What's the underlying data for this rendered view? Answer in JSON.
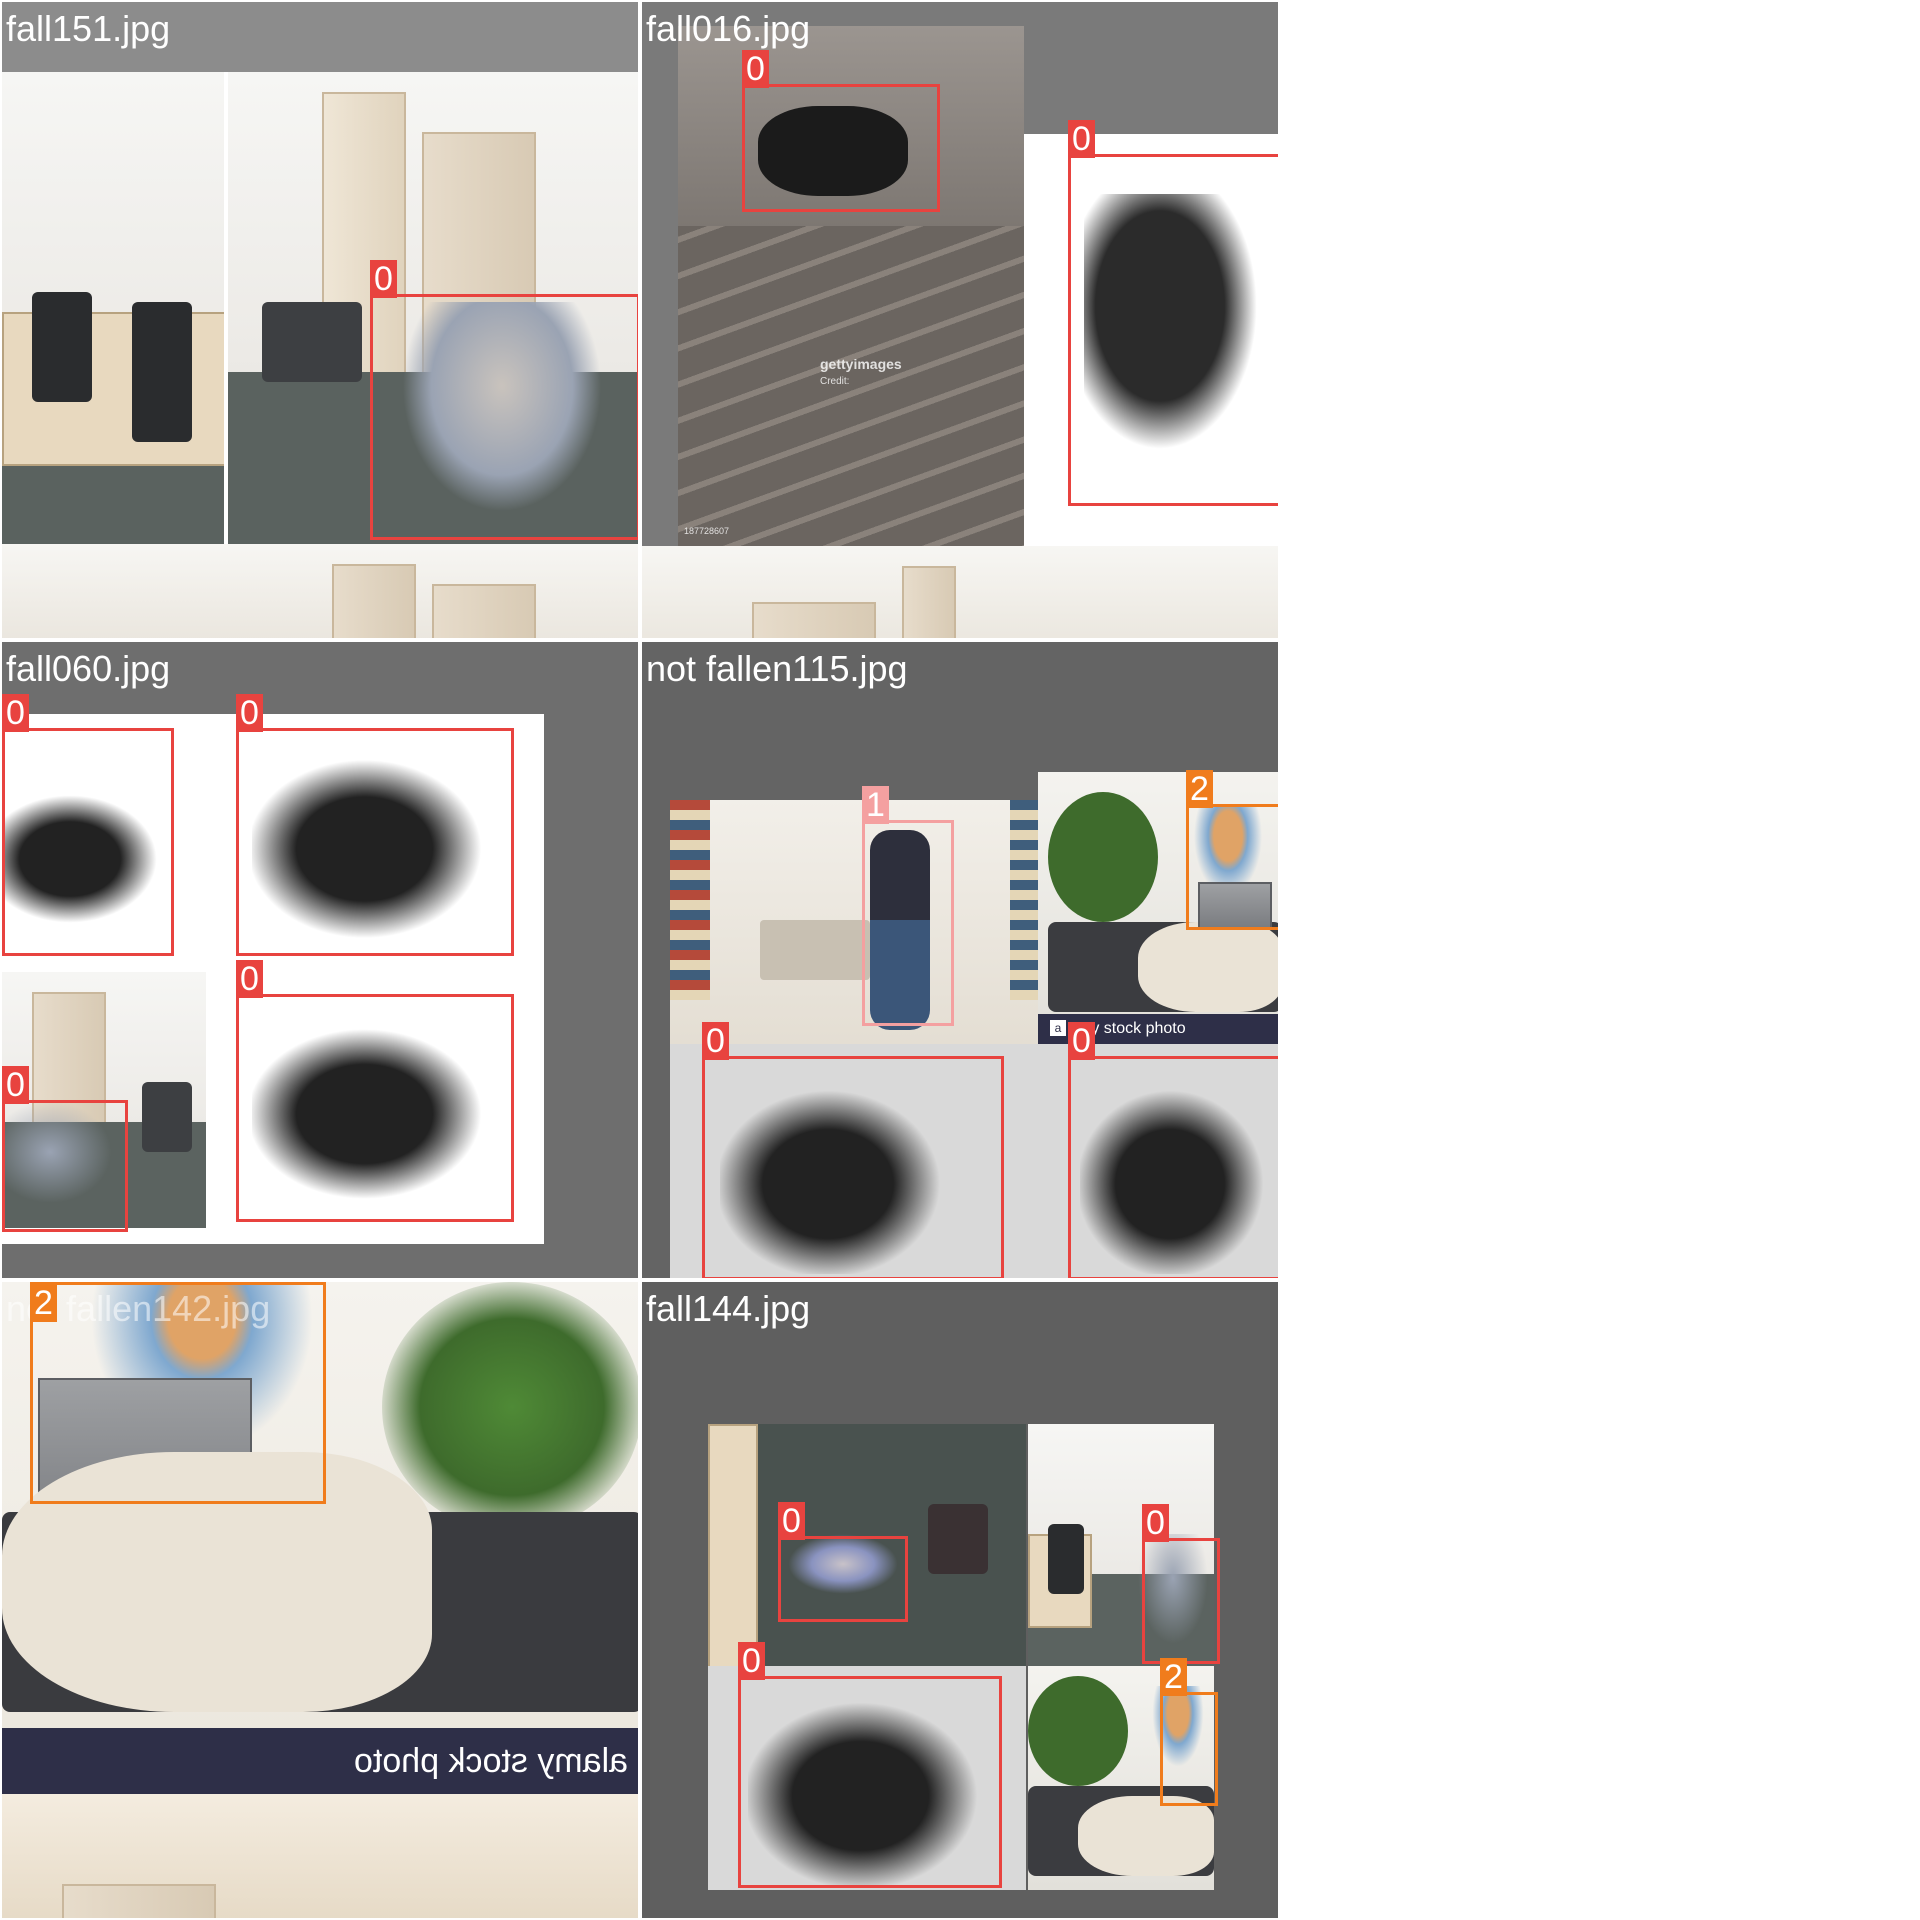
{
  "tiles": [
    {
      "title": "fall151.jpg",
      "bg": "#8c8c8c",
      "labels": [
        "0"
      ]
    },
    {
      "title": "fall016.jpg",
      "bg": "#7a7a7a",
      "labels": [
        "0",
        "0"
      ],
      "watermark": "gettyimages",
      "watermark_sub": "Credit:",
      "image_id": "187728607"
    },
    {
      "title": "fall060.jpg",
      "bg": "#6e6e6e",
      "labels": [
        "0",
        "0",
        "0",
        "0"
      ]
    },
    {
      "title": "not fallen115.jpg",
      "bg": "#646464",
      "labels": [
        "1",
        "2",
        "0",
        "0"
      ],
      "stock_text": "my stock photo",
      "stock_badge": "a"
    },
    {
      "title": "not fallen142.jpg",
      "bg": "#ffffff",
      "labels": [
        "2"
      ],
      "stock_text": "alamy stock photo"
    },
    {
      "title": "fall144.jpg",
      "bg": "#5f5f5f",
      "labels": [
        "0",
        "0",
        "0",
        "2"
      ]
    }
  ],
  "colors": {
    "class0": "#e8433f",
    "class1": "#f4a0a0",
    "class2": "#f07c1c"
  }
}
